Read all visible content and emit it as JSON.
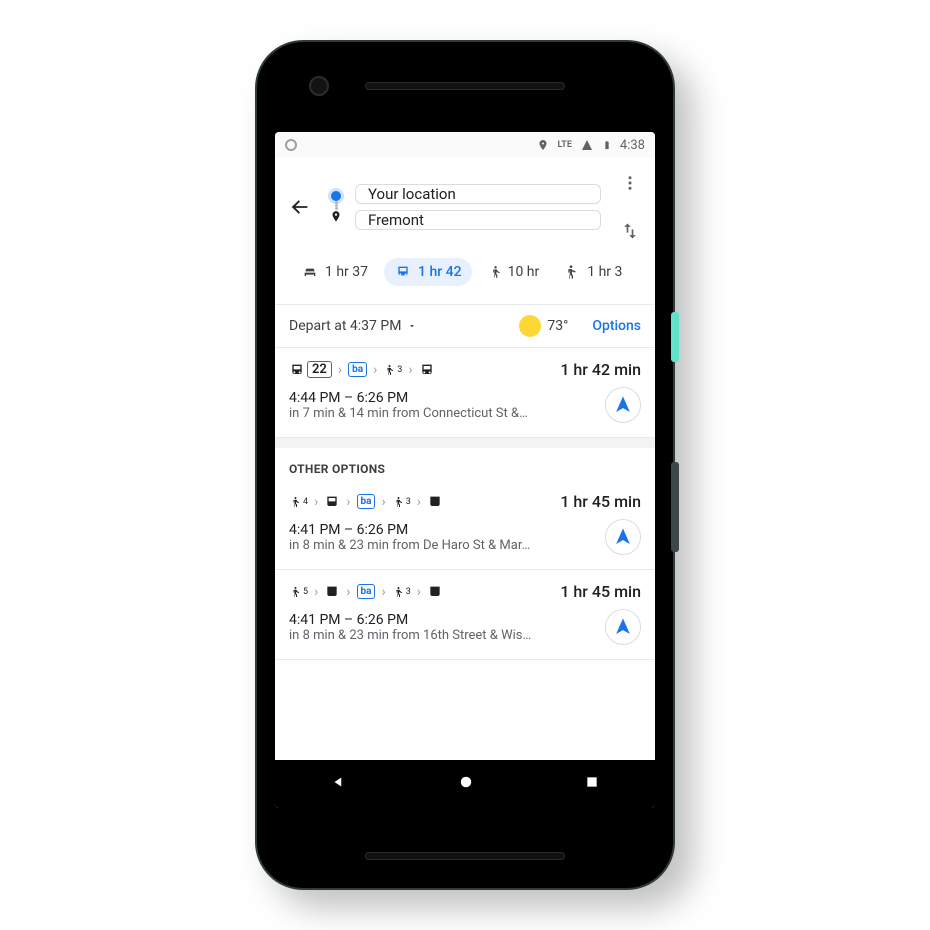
{
  "status": {
    "time": "4:38",
    "signal": "LTE"
  },
  "directions": {
    "from": "Your location",
    "to": "Fremont"
  },
  "modes": [
    {
      "id": "driving",
      "label": "1 hr 37"
    },
    {
      "id": "transit",
      "label": "1 hr 42"
    },
    {
      "id": "walking",
      "label": "10 hr"
    },
    {
      "id": "ride",
      "label": "1 hr 3"
    }
  ],
  "controls": {
    "depart": "Depart at 4:37 PM",
    "temp": "73°",
    "options": "Options"
  },
  "routes": {
    "best": {
      "steps_bus_num": "22",
      "walk_min": "3",
      "duration": "1 hr 42 min",
      "times": "4:44 PM – 6:26 PM",
      "detail": "in 7 min & 14 min from Connecticut St &…"
    },
    "other_title": "OTHER OPTIONS",
    "others": [
      {
        "walk_a": "4",
        "walk_b": "3",
        "duration": "1 hr 45 min",
        "times": "4:41 PM – 6:26 PM",
        "detail": "in 8 min & 23 min from De Haro St & Mar…"
      },
      {
        "walk_a": "5",
        "walk_b": "3",
        "duration": "1 hr 45 min",
        "times": "4:41 PM – 6:26 PM",
        "detail": "in 8 min & 23 min from 16th Street & Wis…"
      }
    ]
  }
}
